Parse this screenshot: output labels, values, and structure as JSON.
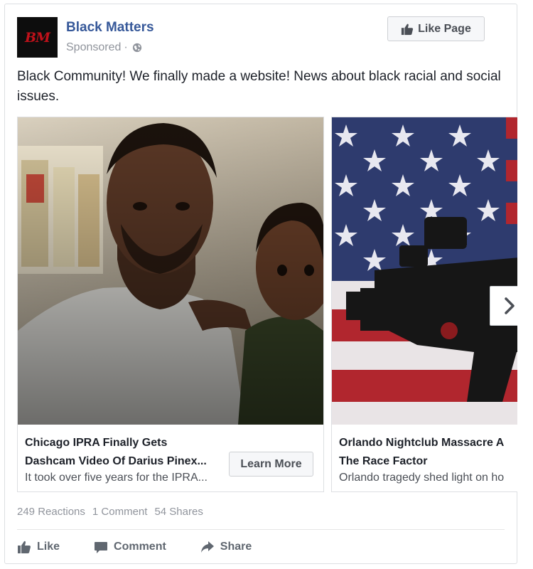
{
  "page": {
    "avatar_text": "BM",
    "name": "Black Matters",
    "sponsored": "Sponsored",
    "sponsored_sep": "·",
    "globe_icon": "globe-icon"
  },
  "like_page_button": {
    "label": "Like Page",
    "icon": "thumbs-up-icon"
  },
  "post_text": "Black Community! We finally made a website! News about black racial and social issues.",
  "cards": [
    {
      "title_line1": "Chicago IPRA Finally Gets",
      "title_line2": "Dashcam Video Of Darius Pinex...",
      "description": "It took over five years for the IPRA...",
      "cta": "Learn More"
    },
    {
      "title_line1": "Orlando Nightclub Massacre A",
      "title_line2": "The Race Factor",
      "description": "Orlando tragedy shed light on ho"
    }
  ],
  "next_icon": "chevron-right-icon",
  "stats": {
    "reactions": "249 Reactions",
    "comments": "1 Comment",
    "shares": "54 Shares"
  },
  "actions": {
    "like": "Like",
    "comment": "Comment",
    "share": "Share"
  },
  "colors": {
    "link_blue": "#365899",
    "meta_gray": "#90949c",
    "button_bg": "#f6f7f9"
  }
}
